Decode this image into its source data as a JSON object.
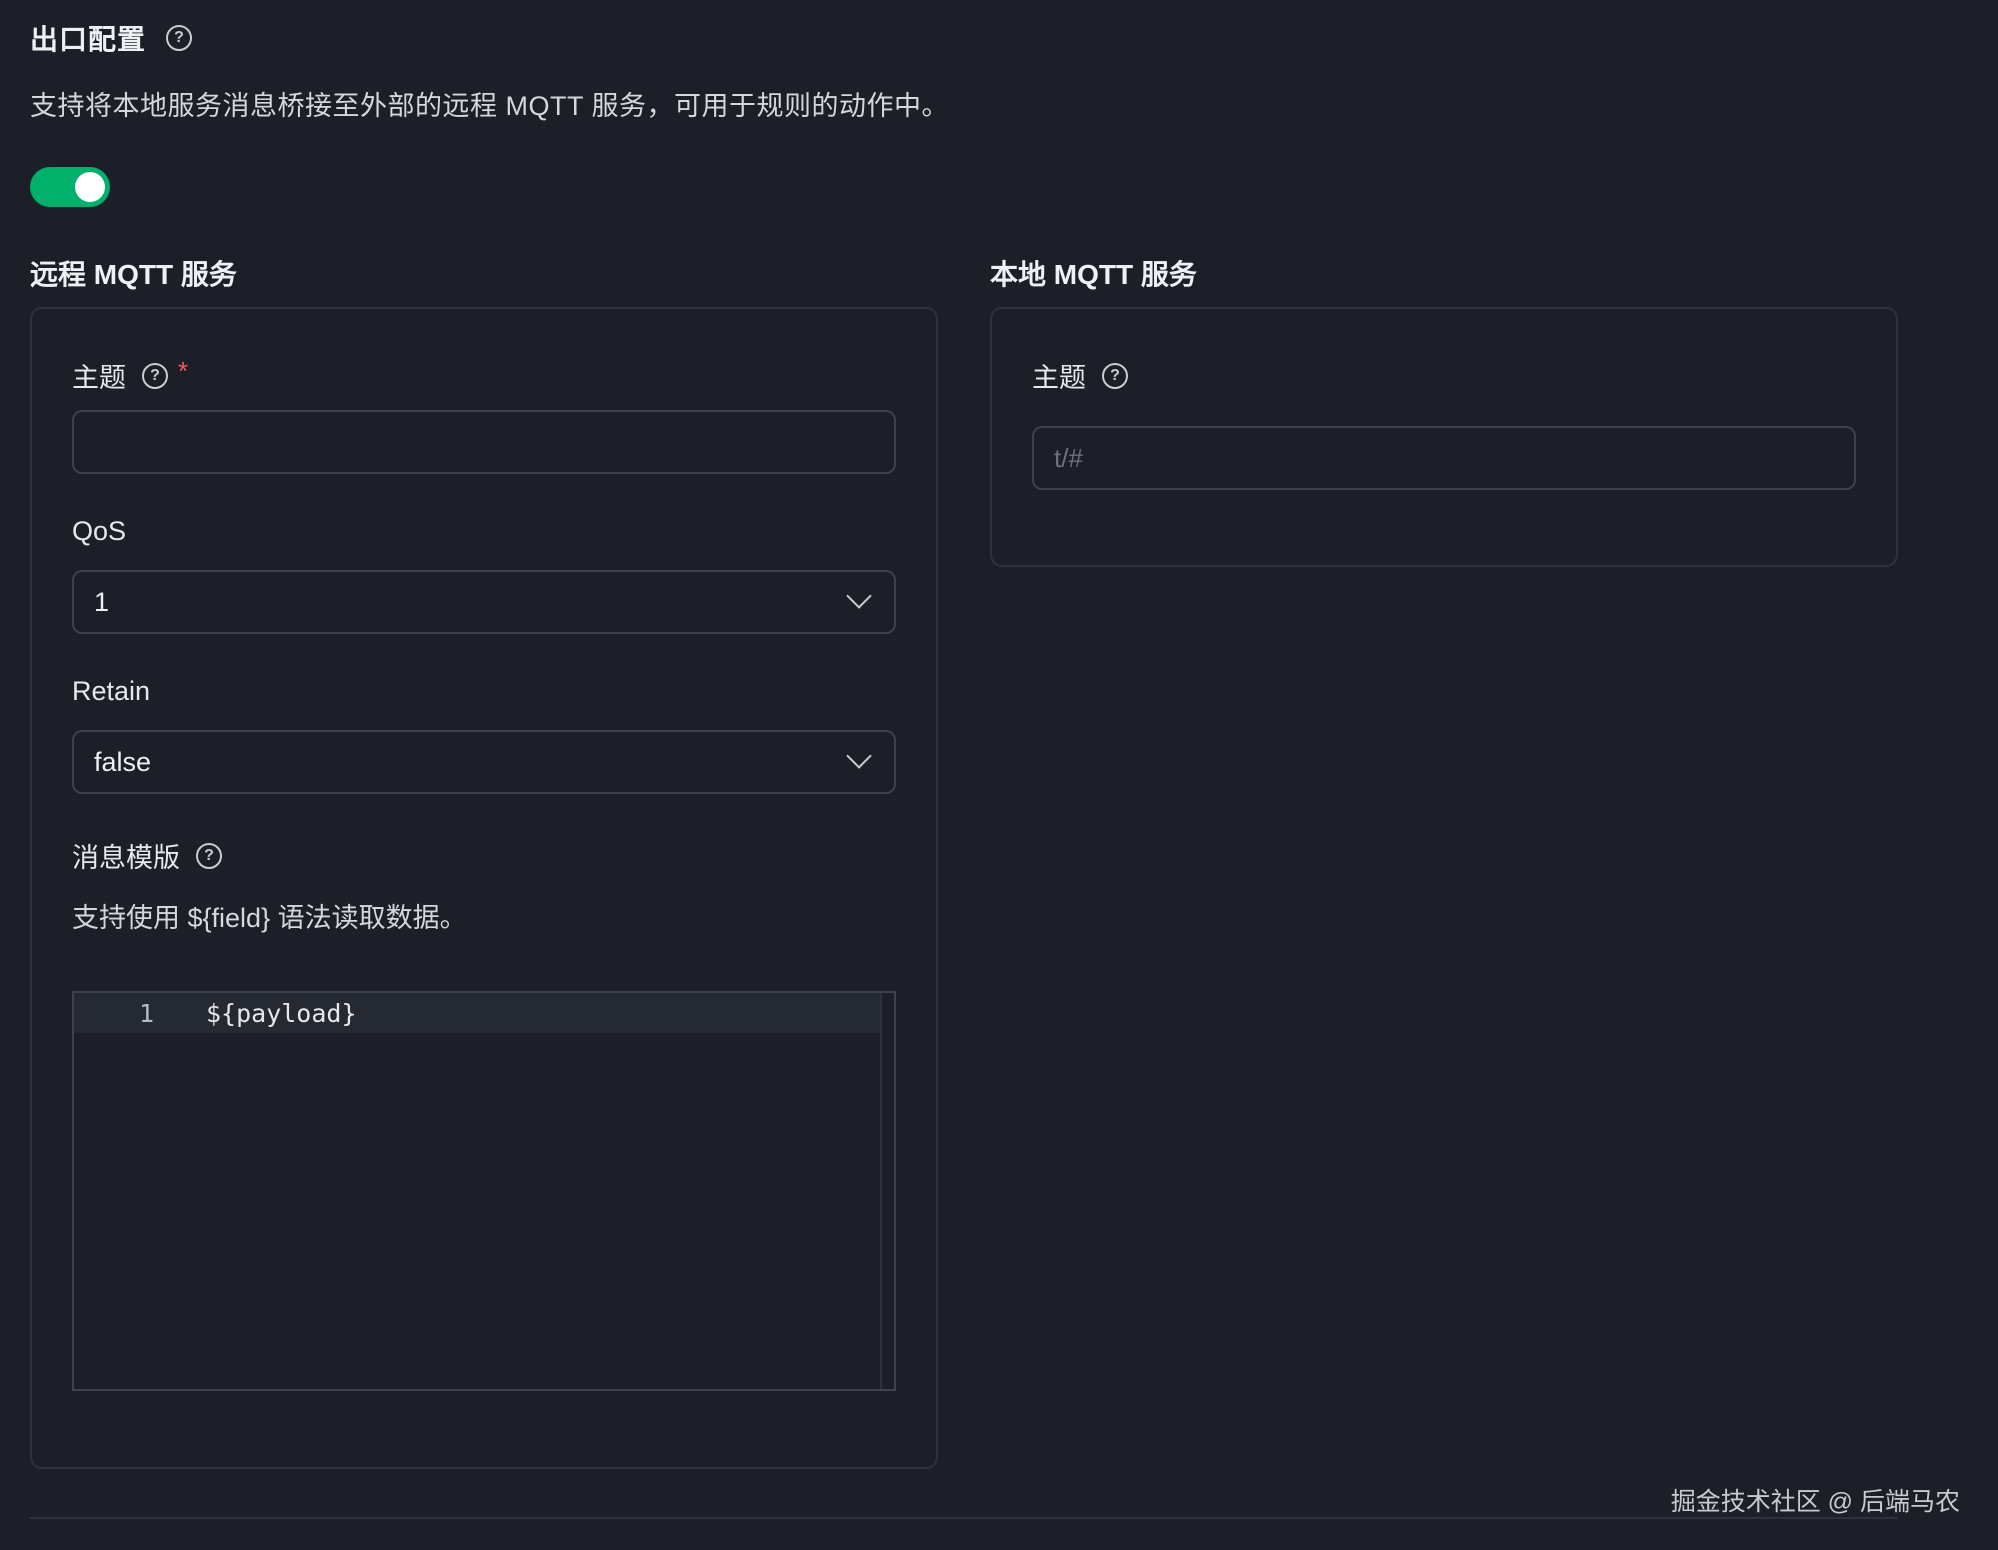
{
  "header": {
    "title": "出口配置",
    "help_icon": "?",
    "description": "支持将本地服务消息桥接至外部的远程 MQTT 服务，可用于规则的动作中。"
  },
  "toggle": {
    "enabled": true,
    "color": "#00b06b"
  },
  "remote": {
    "title": "远程 MQTT 服务",
    "topic": {
      "label": "主题",
      "required_mark": "*",
      "value": "",
      "placeholder": ""
    },
    "qos": {
      "label": "QoS",
      "value": "1"
    },
    "retain": {
      "label": "Retain",
      "value": "false"
    },
    "template": {
      "label": "消息模版",
      "hint": "支持使用 ${field} 语法读取数据。",
      "line_number": "1",
      "code": "${payload}"
    }
  },
  "local": {
    "title": "本地 MQTT 服务",
    "topic": {
      "label": "主题",
      "value": "",
      "placeholder": "t/#"
    }
  },
  "watermark": "掘金技术社区 @ 后端马农",
  "icons": {
    "help": "question-circle-icon",
    "chevron": "chevron-down-icon"
  }
}
